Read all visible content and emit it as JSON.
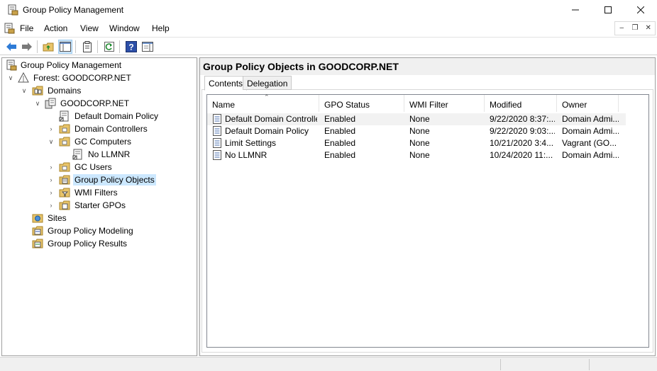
{
  "window": {
    "title": "Group Policy Management",
    "app_icon": "gpmc-icon",
    "controls": [
      "minimize-icon",
      "maximize-icon",
      "close-icon"
    ]
  },
  "menu": {
    "items": [
      "File",
      "Action",
      "View",
      "Window",
      "Help"
    ]
  },
  "toolbar": {
    "buttons": [
      "back-arrow-icon",
      "forward-arrow-icon",
      "up-folder-icon",
      "show-hide-tree-icon",
      "properties-icon",
      "refresh-icon",
      "help-icon",
      "show-action-pane-icon"
    ]
  },
  "tree": {
    "root": "Group Policy Management",
    "forest": "Forest: GOODCORP.NET",
    "domains": "Domains",
    "domain": "GOODCORP.NET",
    "default_domain_policy": "Default Domain Policy",
    "domain_controllers": "Domain Controllers",
    "gc_computers": "GC Computers",
    "no_llmnr": "No LLMNR",
    "gc_users": "GC Users",
    "group_policy_objects": "Group Policy Objects",
    "wmi_filters": "WMI Filters",
    "starter_gpos": "Starter GPOs",
    "sites": "Sites",
    "modeling": "Group Policy Modeling",
    "results": "Group Policy Results"
  },
  "main": {
    "title": "Group Policy Objects in GOODCORP.NET",
    "tabs": [
      "Contents",
      "Delegation"
    ],
    "columns": [
      "Name",
      "GPO Status",
      "WMI Filter",
      "Modified",
      "Owner"
    ],
    "rows": [
      {
        "name": "Default Domain Controller...",
        "status": "Enabled",
        "wmi": "None",
        "modified": "9/22/2020 8:37:...",
        "owner": "Domain Admi..."
      },
      {
        "name": "Default Domain Policy",
        "status": "Enabled",
        "wmi": "None",
        "modified": "9/22/2020 9:03:...",
        "owner": "Domain Admi..."
      },
      {
        "name": "Limit Settings",
        "status": "Enabled",
        "wmi": "None",
        "modified": "10/21/2020 3:4...",
        "owner": "Vagrant (GO..."
      },
      {
        "name": "No LLMNR",
        "status": "Enabled",
        "wmi": "None",
        "modified": "10/24/2020 11:...",
        "owner": "Domain Admi..."
      }
    ]
  },
  "colors": {
    "selection": "#cce8ff",
    "folder": "#e8c46a",
    "toolbar_pressed": "#cce4f7"
  }
}
